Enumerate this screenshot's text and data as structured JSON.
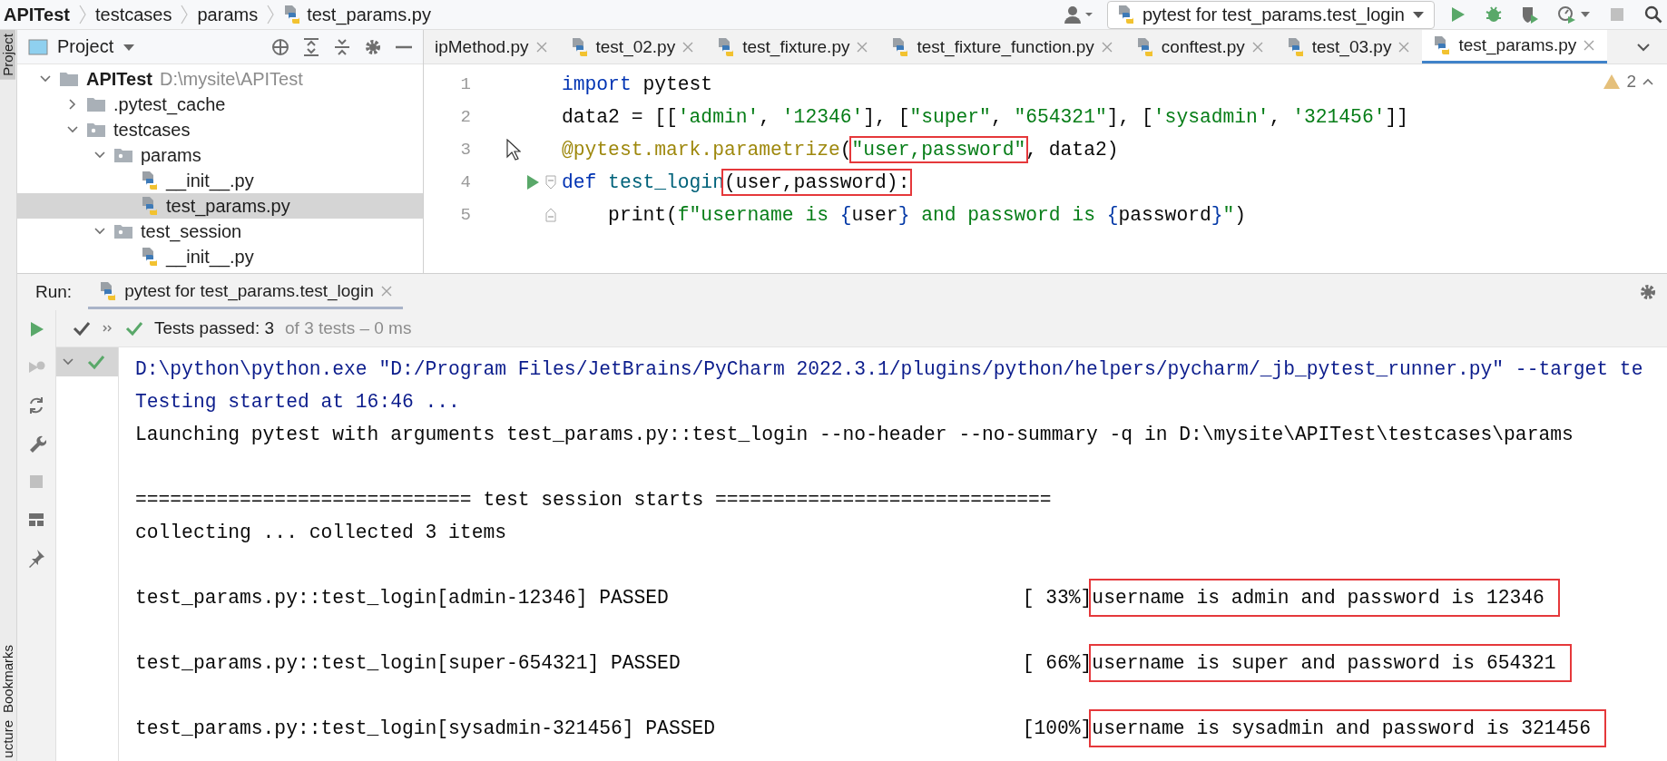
{
  "breadcrumbs": [
    {
      "label": "APITest",
      "kind": "project"
    },
    {
      "label": "testcases",
      "kind": "folder"
    },
    {
      "label": "params",
      "kind": "folder"
    },
    {
      "label": "test_params.py",
      "kind": "file"
    }
  ],
  "main_toolbar": {
    "run_config": "pytest for test_params.test_login",
    "tools": [
      {
        "kind": "run",
        "disabled": false
      },
      {
        "kind": "debug",
        "disabled": false
      },
      {
        "kind": "coverage",
        "disabled": false
      },
      {
        "kind": "profile",
        "disabled": false
      },
      {
        "kind": "stop",
        "disabled": true
      },
      {
        "kind": "search",
        "disabled": false
      }
    ]
  },
  "side_stripe": {
    "top": [
      {
        "label": "Project",
        "selected": true
      }
    ],
    "bottom": [
      {
        "label": "Bookmarks",
        "selected": false
      },
      {
        "label": "ucture",
        "selected": false
      }
    ]
  },
  "project_panel": {
    "title": "Project",
    "tree": [
      {
        "name": "APITest",
        "path": "D:\\mysite\\APITest",
        "kind": "module",
        "expanded": true,
        "selected": false,
        "children": [
          {
            "name": ".pytest_cache",
            "kind": "folder",
            "expanded": false,
            "selected": false
          },
          {
            "name": "testcases",
            "kind": "package",
            "expanded": true,
            "selected": false,
            "children": [
              {
                "name": "params",
                "kind": "package",
                "expanded": true,
                "selected": false,
                "children": [
                  {
                    "name": "__init__.py",
                    "kind": "file",
                    "selected": false
                  },
                  {
                    "name": "test_params.py",
                    "kind": "file",
                    "selected": true
                  }
                ]
              },
              {
                "name": "test_session",
                "kind": "package",
                "expanded": true,
                "selected": false,
                "children": [
                  {
                    "name": "__init__.py",
                    "kind": "file",
                    "selected": false
                  }
                ]
              }
            ]
          }
        ]
      }
    ]
  },
  "editor": {
    "tabs": [
      {
        "label": "ipMethod.py",
        "selected": false,
        "icon": false
      },
      {
        "label": "test_02.py",
        "selected": false,
        "icon": true
      },
      {
        "label": "test_fixture.py",
        "selected": false,
        "icon": true
      },
      {
        "label": "test_fixture_function.py",
        "selected": false,
        "icon": true
      },
      {
        "label": "conftest.py",
        "selected": false,
        "icon": true
      },
      {
        "label": "test_03.py",
        "selected": false,
        "icon": true
      },
      {
        "label": "test_params.py",
        "selected": true,
        "icon": true
      }
    ],
    "warning_count": "2",
    "lines": [
      {
        "number": "1",
        "tokens": [
          {
            "text": "import",
            "kind": "keyword",
            "boxed": false
          },
          {
            "text": " pytest",
            "kind": "plain",
            "boxed": false
          }
        ]
      },
      {
        "number": "2",
        "tokens": [
          {
            "text": "data2 = [[",
            "kind": "plain",
            "boxed": false
          },
          {
            "text": "'admin'",
            "kind": "string",
            "boxed": false
          },
          {
            "text": ", ",
            "kind": "plain",
            "boxed": false
          },
          {
            "text": "'12346'",
            "kind": "string",
            "boxed": false
          },
          {
            "text": "], [",
            "kind": "plain",
            "boxed": false
          },
          {
            "text": "\"super\"",
            "kind": "string",
            "boxed": false
          },
          {
            "text": ", ",
            "kind": "plain",
            "boxed": false
          },
          {
            "text": "\"654321\"",
            "kind": "string",
            "boxed": false
          },
          {
            "text": "], [",
            "kind": "plain",
            "boxed": false
          },
          {
            "text": "'sysadmin'",
            "kind": "string",
            "boxed": false
          },
          {
            "text": ", ",
            "kind": "plain",
            "boxed": false
          },
          {
            "text": "'321456'",
            "kind": "string",
            "boxed": false
          },
          {
            "text": "]]",
            "kind": "plain",
            "boxed": false
          }
        ]
      },
      {
        "number": "3",
        "gutter": [
          {
            "kind": "mouse-pointer"
          }
        ],
        "tokens": [
          {
            "text": "@pytest.mark.parametrize",
            "kind": "decorator",
            "boxed": false
          },
          {
            "text": "(",
            "kind": "plain",
            "boxed": false
          },
          {
            "text": "\"user,password\"",
            "kind": "string",
            "boxed": true
          },
          {
            "text": ", data2)",
            "kind": "plain",
            "boxed": false
          }
        ]
      },
      {
        "number": "4",
        "gutter": [
          {
            "kind": "run"
          },
          {
            "kind": "fold-open"
          }
        ],
        "tokens": [
          {
            "text": "def",
            "kind": "keyword",
            "boxed": false
          },
          {
            "text": " test_login",
            "kind": "function",
            "boxed": false
          },
          {
            "text": "(user,password):",
            "kind": "plain",
            "boxed": true
          }
        ]
      },
      {
        "number": "5",
        "gutter": [
          {
            "kind": "fold-close"
          }
        ],
        "tokens": [
          {
            "text": "    print(",
            "kind": "plain",
            "boxed": false
          },
          {
            "text": "f\"username is ",
            "kind": "string",
            "boxed": false
          },
          {
            "text": "{",
            "kind": "brace",
            "boxed": false
          },
          {
            "text": "user",
            "kind": "plain",
            "boxed": false
          },
          {
            "text": "}",
            "kind": "brace",
            "boxed": false
          },
          {
            "text": " and password is ",
            "kind": "string",
            "boxed": false
          },
          {
            "text": "{",
            "kind": "brace",
            "boxed": false
          },
          {
            "text": "password",
            "kind": "plain",
            "boxed": false
          },
          {
            "text": "}",
            "kind": "brace",
            "boxed": false
          },
          {
            "text": "\"",
            "kind": "string",
            "boxed": false
          },
          {
            "text": ")",
            "kind": "plain",
            "boxed": false
          }
        ]
      }
    ]
  },
  "run_panel": {
    "label": "Run:",
    "tab": "pytest for test_params.test_login",
    "status": {
      "passed": "Tests passed: 3",
      "detail": "of 3 tests – 0 ms"
    },
    "side_tools": [
      {
        "kind": "rerun",
        "disabled": false
      },
      {
        "kind": "rerun-failed",
        "disabled": true
      },
      {
        "kind": "auto-test",
        "disabled": false
      },
      {
        "kind": "wrench",
        "disabled": false
      },
      {
        "kind": "stop",
        "disabled": true
      },
      {
        "kind": "layout",
        "disabled": false
      },
      {
        "kind": "pin",
        "disabled": false
      }
    ],
    "console": [
      {
        "kind": "system",
        "text": "D:\\python\\python.exe \"D:/Program Files/JetBrains/PyCharm 2022.3.1/plugins/python/helpers/pycharm/_jb_pytest_runner.py\" --target te"
      },
      {
        "kind": "system",
        "text": "Testing started at 16:46 ..."
      },
      {
        "kind": "stdout",
        "text": "Launching pytest with arguments test_params.py::test_login --no-header --no-summary -q in D:\\mysite\\APITest\\testcases\\params"
      },
      {
        "kind": "separator",
        "text": "============================= test session starts ============================="
      },
      {
        "kind": "stdout",
        "text": "collecting ... collected 3 items"
      },
      {
        "kind": "result",
        "text": "test_params.py::test_login[admin-12346] PASSED",
        "progress": "[ 33%]",
        "output": "username is admin and password is 12346",
        "boxed": true
      },
      {
        "kind": "result",
        "text": "test_params.py::test_login[super-654321] PASSED",
        "progress": "[ 66%]",
        "output": "username is super and password is 654321",
        "boxed": true
      },
      {
        "kind": "result",
        "text": "test_params.py::test_login[sysadmin-321456] PASSED",
        "progress": "[100%]",
        "output": "username is sysadmin and password is 321456",
        "boxed": true
      }
    ]
  }
}
